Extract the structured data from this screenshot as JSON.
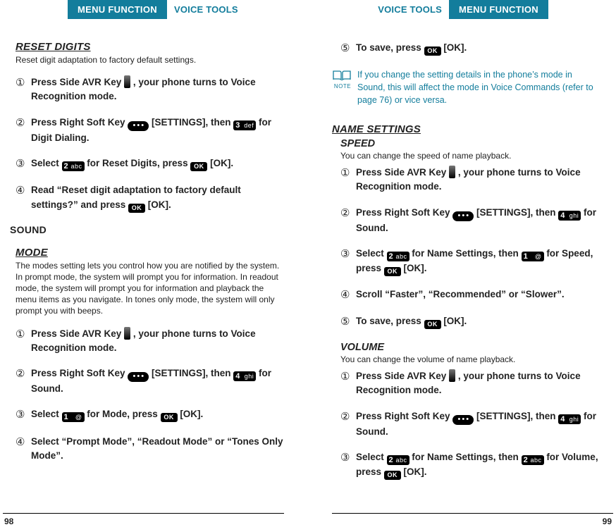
{
  "header": {
    "menu_function": "MENU FUNCTION",
    "voice_tools": "VOICE TOOLS"
  },
  "left": {
    "reset_digits": {
      "title": "RESET DIGITS",
      "desc": "Reset digit adaptation to factory default settings.",
      "steps": {
        "s1a": "Press Side AVR Key ",
        "s1b": " , your phone turns to Voice Recognition mode.",
        "s2a": "Press Right Soft Key ",
        "s2b": " [SETTINGS], then ",
        "s2c": " for Digit Dialing.",
        "s3a": "Select ",
        "s3b": " for Reset Digits, press ",
        "s3c": " [OK].",
        "s4a": "Read “Reset digit adaptation to factory default settings?” and press ",
        "s4b": " [OK]."
      }
    },
    "sound_heading": "SOUND",
    "mode": {
      "title": "MODE",
      "desc": "The modes setting lets you control how you are notified by the system. In prompt mode, the system will prompt you for information. In readout mode, the system will prompt you for information and playback the menu items as you navigate. In tones only mode, the system will only prompt you with beeps.",
      "steps": {
        "s1a": "Press Side AVR Key ",
        "s1b": " , your phone turns to Voice Recognition mode.",
        "s2a": "Press Right Soft Key ",
        "s2b": " [SETTINGS], then ",
        "s2c": " for Sound.",
        "s3a": "Select ",
        "s3b": " for Mode, press ",
        "s3c": " [OK].",
        "s4": "Select “Prompt Mode”, “Readout Mode” or “Tones Only Mode”."
      }
    },
    "page_number": "98"
  },
  "right": {
    "cont": {
      "s5a": "To save, press ",
      "s5b": " [OK]."
    },
    "note": "If you change the setting details in the phone’s mode in Sound, this will affect the mode in Voice Commands (refer to page 76) or vice versa.",
    "note_label": "NOTE",
    "name_settings_title": "NAME SETTINGS",
    "speed": {
      "title": "SPEED",
      "desc": "You can change the speed of name playback.",
      "steps": {
        "s1a": "Press Side AVR Key ",
        "s1b": " , your phone turns to Voice Recognition mode.",
        "s2a": "Press Right Soft Key ",
        "s2b": " [SETTINGS], then ",
        "s2c": " for Sound.",
        "s3a": "Select ",
        "s3b": " for Name Settings, then ",
        "s3c": " for Speed, press ",
        "s3d": " [OK].",
        "s4": "Scroll “Faster”, “Recommended” or “Slower”.",
        "s5a": "To save, press ",
        "s5b": " [OK]."
      }
    },
    "volume": {
      "title": "VOLUME",
      "desc": "You can change the volume of name playback.",
      "steps": {
        "s1a": "Press Side AVR Key ",
        "s1b": " , your phone turns to Voice Recognition mode.",
        "s2a": "Press Right Soft Key ",
        "s2b": " [SETTINGS], then ",
        "s2c": " for Sound.",
        "s3a": "Select ",
        "s3b": " for Name Settings, then ",
        "s3c": " for Volume, press ",
        "s3d": " [OK]."
      }
    },
    "page_number": "99"
  },
  "nums": {
    "n1": "①",
    "n2": "②",
    "n3": "③",
    "n4": "④",
    "n5": "⑤"
  },
  "keys": {
    "ok": "OK",
    "dots": "•••",
    "k1_big": "1",
    "k1_small": "@",
    "k2_big": "2",
    "k2_small": "abc",
    "k3_big": "3",
    "k3_small": "def",
    "k4_big": "4",
    "k4_small": "ghi"
  }
}
